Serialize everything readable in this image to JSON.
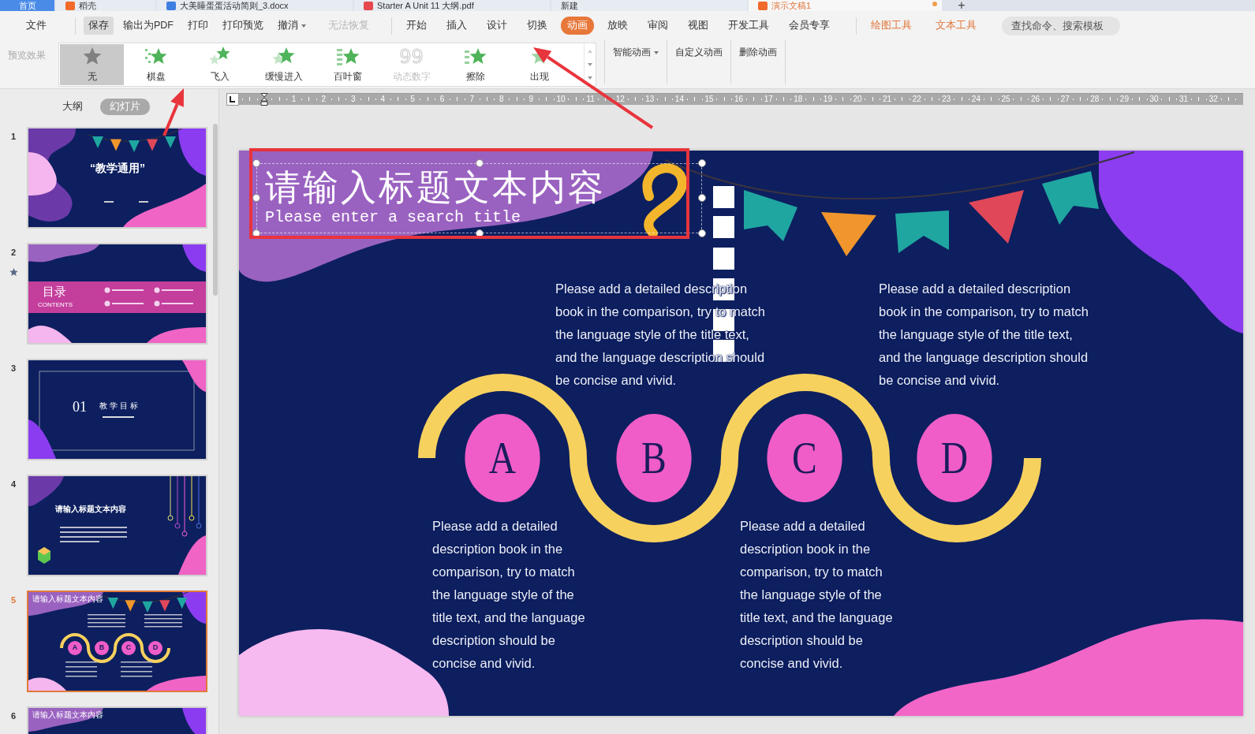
{
  "doc_tabs": [
    {
      "label": "首页",
      "kind": "home",
      "selected": false
    },
    {
      "label": "稻壳",
      "kind": "daoke",
      "selected": false
    },
    {
      "label": "大美睡蛋蛋活动简则_3.docx",
      "kind": "doc",
      "selected": false
    },
    {
      "label": "Starter A Unit 11 大纲.pdf",
      "kind": "pdf",
      "selected": false
    },
    {
      "label": "新建",
      "kind": "new",
      "selected": false
    },
    {
      "label": "演示文稿1",
      "kind": "ppt",
      "selected": true
    }
  ],
  "new_tab_button": "+",
  "file_menu": "文件",
  "quick_actions": [
    {
      "label": "保存",
      "highlighted": true,
      "disabled": false,
      "dropdown": false
    },
    {
      "label": "输出为PDF",
      "highlighted": false,
      "disabled": false,
      "dropdown": false
    },
    {
      "label": "打印",
      "highlighted": false,
      "disabled": false,
      "dropdown": false
    },
    {
      "label": "打印预览",
      "highlighted": false,
      "disabled": false,
      "dropdown": false
    },
    {
      "label": "撤消",
      "highlighted": false,
      "disabled": false,
      "dropdown": true
    },
    {
      "label": "无法恢复",
      "highlighted": false,
      "disabled": true,
      "dropdown": false
    }
  ],
  "ribbon_tabs": [
    {
      "label": "开始",
      "kind": "normal",
      "selected": false
    },
    {
      "label": "插入",
      "kind": "normal",
      "selected": false
    },
    {
      "label": "设计",
      "kind": "normal",
      "selected": false
    },
    {
      "label": "切换",
      "kind": "normal",
      "selected": false
    },
    {
      "label": "动画",
      "kind": "normal",
      "selected": true
    },
    {
      "label": "放映",
      "kind": "normal",
      "selected": false
    },
    {
      "label": "审阅",
      "kind": "normal",
      "selected": false
    },
    {
      "label": "视图",
      "kind": "normal",
      "selected": false
    },
    {
      "label": "开发工具",
      "kind": "normal",
      "selected": false
    },
    {
      "label": "会员专享",
      "kind": "normal",
      "selected": false
    },
    {
      "label": "绘图工具",
      "kind": "context",
      "selected": false
    },
    {
      "label": "文本工具",
      "kind": "context",
      "selected": false
    }
  ],
  "search": {
    "placeholder": "查找命令、搜索模板"
  },
  "animation_gallery": {
    "preview_label": "预览效果",
    "preview_disabled": true,
    "effects": [
      {
        "label": "无",
        "kind": "none",
        "selected": true,
        "disabled": false
      },
      {
        "label": "棋盘",
        "kind": "checker",
        "selected": false,
        "disabled": false
      },
      {
        "label": "飞入",
        "kind": "fly",
        "selected": false,
        "disabled": false
      },
      {
        "label": "缓慢进入",
        "kind": "slow",
        "selected": false,
        "disabled": false
      },
      {
        "label": "百叶窗",
        "kind": "blinds",
        "selected": false,
        "disabled": false
      },
      {
        "label": "动态数字",
        "kind": "digits",
        "glyph": "99",
        "selected": false,
        "disabled": true
      },
      {
        "label": "擦除",
        "kind": "wipe",
        "selected": false,
        "disabled": false
      },
      {
        "label": "出现",
        "kind": "appear",
        "selected": false,
        "disabled": false
      }
    ]
  },
  "animation_actions": [
    {
      "label": "智能动画",
      "dropdown": true
    },
    {
      "label": "自定义动画",
      "dropdown": false
    },
    {
      "label": "删除动画",
      "dropdown": false
    }
  ],
  "panel": {
    "tabs": [
      {
        "label": "大纲",
        "selected": false
      },
      {
        "label": "幻灯片",
        "selected": true
      }
    ],
    "thumbnails": [
      {
        "number": "1",
        "kind": "cover",
        "selected": false,
        "animated": false,
        "title": "“教学通用”"
      },
      {
        "number": "2",
        "kind": "contents",
        "selected": false,
        "animated": true,
        "title": "目录",
        "subtitle": "CONTENTS"
      },
      {
        "number": "3",
        "kind": "section",
        "selected": false,
        "animated": false,
        "title": "教学目标",
        "section": "01"
      },
      {
        "number": "4",
        "kind": "content",
        "selected": false,
        "animated": false,
        "title": "请输入标题文本内容"
      },
      {
        "number": "5",
        "kind": "abcd",
        "selected": true,
        "animated": false,
        "title": "请输入标题文本内容",
        "letters": [
          "A",
          "B",
          "C",
          "D"
        ]
      },
      {
        "number": "6",
        "kind": "title",
        "selected": false,
        "animated": false,
        "title": "请输入标题文本内容"
      }
    ]
  },
  "ruler": {
    "labels": [
      "1",
      "2",
      "3",
      "4",
      "5",
      "6",
      "7",
      "8",
      "9",
      "10",
      "11",
      "12",
      "13",
      "14",
      "15",
      "16",
      "17",
      "18",
      "19",
      "20",
      "21",
      "22",
      "23",
      "24",
      "25",
      "26",
      "27",
      "28",
      "29",
      "30",
      "31",
      "32"
    ]
  },
  "slide": {
    "title": "请输入标题文本内容",
    "subtitle": "Please enter a search title",
    "title_selected": true,
    "descriptions": [
      {
        "lines": [
          "Please add a detailed description",
          "book in the comparison, try to match",
          "the language style of the title text,",
          "and the language description should",
          "be concise and vivid."
        ]
      },
      {
        "lines": [
          "Please add a detailed description",
          "book in the comparison, try to match",
          "the language style of the title text,",
          "and the language description should",
          "be concise and vivid."
        ]
      },
      {
        "lines": [
          "Please add a detailed",
          "description book in the",
          "comparison, try to match",
          "the language style of the",
          "title text, and the language",
          "description should be",
          "concise and vivid."
        ]
      },
      {
        "lines": [
          "Please add a detailed",
          "description book in the",
          "comparison, try to match",
          "the language style of the",
          "title text, and the language",
          "description should be",
          "concise and vivid."
        ]
      }
    ],
    "circles": [
      "A",
      "B",
      "C",
      "D"
    ]
  }
}
